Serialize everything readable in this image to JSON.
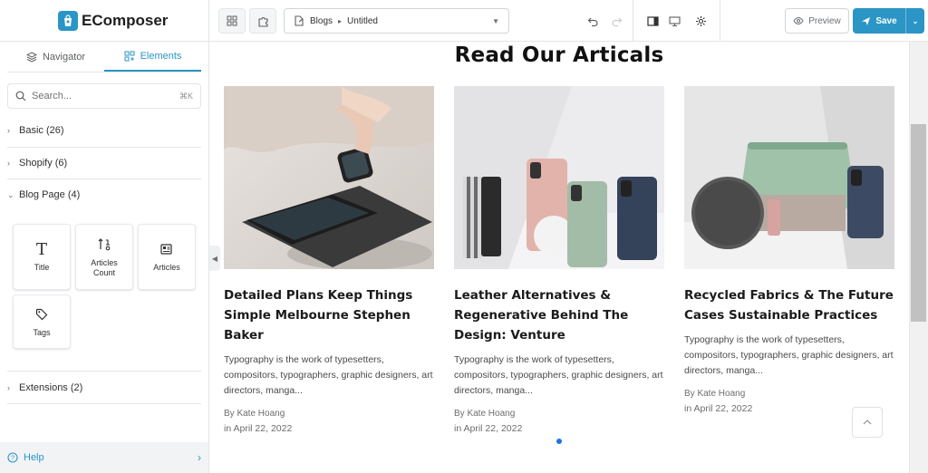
{
  "app": {
    "brand": "EComposer"
  },
  "sidebar": {
    "tabs": [
      {
        "label": "Navigator",
        "icon": "layers-icon"
      },
      {
        "label": "Elements",
        "icon": "grid-plus-icon"
      }
    ],
    "search": {
      "placeholder": "Search...",
      "shortcut": "⌘K"
    },
    "categories": [
      {
        "label": "Basic (26)",
        "expanded": false
      },
      {
        "label": "Shopify (6)",
        "expanded": false
      },
      {
        "label": "Blog Page (4)",
        "expanded": true
      },
      {
        "label": "Extensions (2)",
        "expanded": false
      }
    ],
    "blog_elements": [
      {
        "label": "Title",
        "icon": "text-icon"
      },
      {
        "label": "Articles Count",
        "icon": "sort-count-icon"
      },
      {
        "label": "Articles",
        "icon": "newspaper-icon"
      },
      {
        "label": "Tags",
        "icon": "tag-icon"
      }
    ],
    "help": "Help"
  },
  "topbar": {
    "breadcrumb": [
      "Blogs",
      "Untitled"
    ],
    "preview": "Preview",
    "save": "Save"
  },
  "canvas": {
    "section_title": "Read Our Articals",
    "articles": [
      {
        "title": "Detailed Plans Keep Things Simple Melbourne Stephen Baker",
        "excerpt": "Typography is the work of typesetters, compositors, typographers, graphic designers, art directors, manga...",
        "author": "By Kate Hoang",
        "date": "in April 22, 2022"
      },
      {
        "title": "Leather Alternatives & Regenerative Behind The Design: Venture",
        "excerpt": "Typography is the work of typesetters, compositors, typographers, graphic designers, art directors, manga...",
        "author": "By Kate Hoang",
        "date": "in April 22, 2022"
      },
      {
        "title": "Recycled Fabrics & The Future Cases Sustainable Practices",
        "excerpt": "Typography is the work of typesetters, compositors, typographers, graphic designers, art directors, manga...",
        "author": "By Kate Hoang",
        "date": "in April 22, 2022"
      }
    ]
  },
  "colors": {
    "accent": "#2b95c6",
    "pager_dot": "#1a73e8"
  }
}
